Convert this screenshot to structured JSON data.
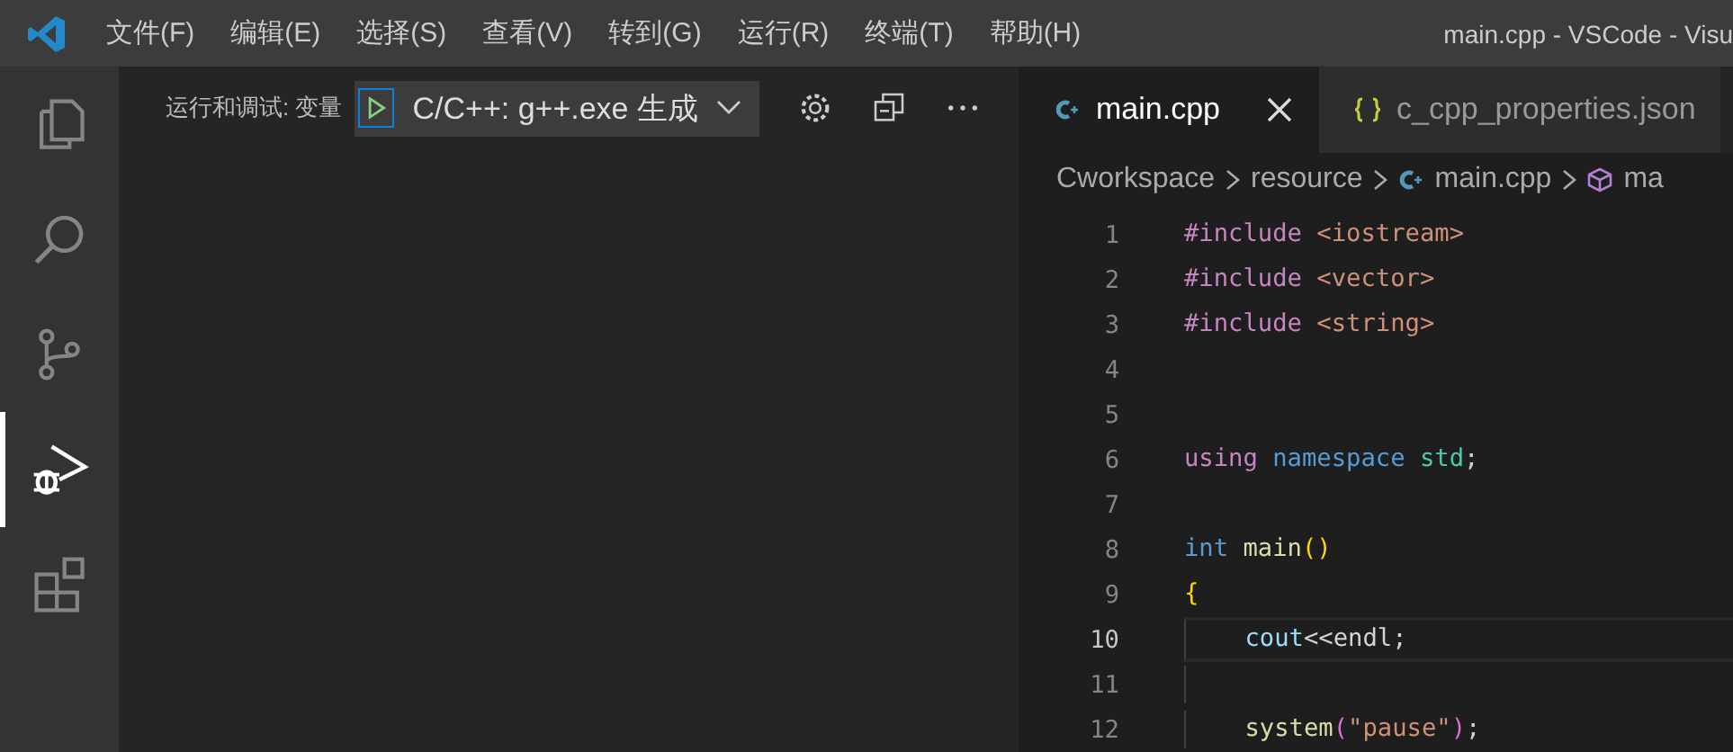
{
  "title_bar": {
    "menu": [
      "文件(F)",
      "编辑(E)",
      "选择(S)",
      "查看(V)",
      "转到(G)",
      "运行(R)",
      "终端(T)",
      "帮助(H)"
    ],
    "title": "main.cpp - VSCode - Visu"
  },
  "activity_bar": [
    {
      "kind": "files",
      "selected": false
    },
    {
      "kind": "search",
      "selected": false
    },
    {
      "kind": "branch",
      "selected": false
    },
    {
      "kind": "debug",
      "selected": true
    },
    {
      "kind": "blocks",
      "selected": false
    }
  ],
  "sidebar": {
    "title": "运行和调试: 变量",
    "config": "C/C++: g++.exe 生成"
  },
  "tabs": [
    {
      "label": "main.cpp",
      "kind": "cpp",
      "selected": true
    },
    {
      "label": "c_cpp_properties.json",
      "kind": "json",
      "selected": false
    }
  ],
  "breadcrumb": [
    {
      "label": "Cworkspace",
      "kind": "folder"
    },
    {
      "label": "resource",
      "kind": "folder"
    },
    {
      "label": "main.cpp",
      "kind": "cpp"
    },
    {
      "label": "ma",
      "kind": "symbol"
    }
  ],
  "code": [
    {
      "number": "1",
      "current": false,
      "tokens": [
        {
          "text": "#include",
          "kind": "directive"
        },
        {
          "text": " <iostream>",
          "kind": "string"
        }
      ]
    },
    {
      "number": "2",
      "current": false,
      "tokens": [
        {
          "text": "#include",
          "kind": "directive"
        },
        {
          "text": " <vector>",
          "kind": "string"
        }
      ]
    },
    {
      "number": "3",
      "current": false,
      "tokens": [
        {
          "text": "#include",
          "kind": "directive"
        },
        {
          "text": " <string>",
          "kind": "string"
        }
      ]
    },
    {
      "number": "4",
      "current": false
    },
    {
      "number": "5",
      "current": false
    },
    {
      "number": "6",
      "current": false,
      "tokens": [
        {
          "text": "using",
          "kind": "control"
        },
        {
          "text": " namespace",
          "kind": "keyword"
        },
        {
          "text": " std",
          "kind": "type"
        },
        {
          "text": ";",
          "kind": "plain"
        }
      ]
    },
    {
      "number": "7",
      "current": false
    },
    {
      "number": "8",
      "current": false,
      "tokens": [
        {
          "text": "int",
          "kind": "keyword"
        },
        {
          "text": " main",
          "kind": "function"
        },
        {
          "text": "()",
          "kind": "bracket"
        }
      ]
    },
    {
      "number": "9",
      "current": false,
      "tokens": [
        {
          "text": "{",
          "kind": "bracket"
        }
      ]
    },
    {
      "number": "10",
      "current": true,
      "tokens": [
        {
          "text": "    cout",
          "kind": "variable"
        },
        {
          "text": "<<endl;",
          "kind": "plain"
        }
      ]
    },
    {
      "number": "11",
      "current": false
    },
    {
      "number": "12",
      "current": false,
      "tokens": [
        {
          "text": "    system",
          "kind": "function"
        },
        {
          "text": "(",
          "kind": "bracket2"
        },
        {
          "text": "\"pause\"",
          "kind": "string"
        },
        {
          "text": ")",
          "kind": "bracket2"
        },
        {
          "text": ";",
          "kind": "plain"
        }
      ]
    }
  ]
}
